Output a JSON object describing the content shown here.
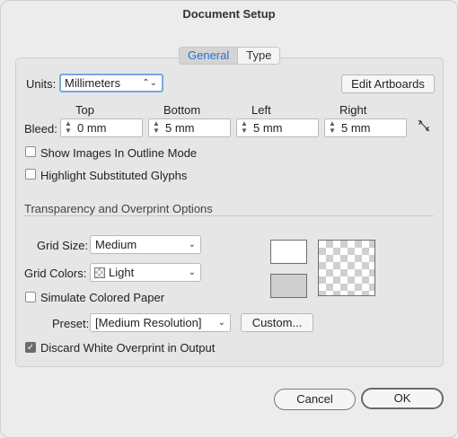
{
  "window": {
    "title": "Document Setup"
  },
  "tabs": [
    {
      "label": "General",
      "active": true
    },
    {
      "label": "Type",
      "active": false
    }
  ],
  "units": {
    "label": "Units:",
    "value": "Millimeters"
  },
  "edit_artboards_label": "Edit Artboards",
  "bleed": {
    "label": "Bleed:",
    "top": {
      "label": "Top",
      "value": "0 mm"
    },
    "bottom": {
      "label": "Bottom",
      "value": "5 mm"
    },
    "left": {
      "label": "Left",
      "value": "5 mm"
    },
    "right": {
      "label": "Right",
      "value": "5 mm"
    },
    "link_icon": "broken-link-icon"
  },
  "options": {
    "show_images_outline": {
      "label": "Show Images In Outline Mode",
      "checked": false
    },
    "highlight_glyphs": {
      "label": "Highlight Substituted Glyphs",
      "checked": false
    }
  },
  "transparency": {
    "section_title": "Transparency and Overprint Options",
    "grid_size": {
      "label": "Grid Size:",
      "value": "Medium"
    },
    "grid_colors": {
      "label": "Grid Colors:",
      "value": "Light"
    },
    "simulate_paper": {
      "label": "Simulate Colored Paper",
      "checked": false
    },
    "preset": {
      "label": "Preset:",
      "value": "[Medium Resolution]"
    },
    "custom_label": "Custom...",
    "discard_white": {
      "label": "Discard White Overprint in Output",
      "checked": true
    },
    "colors": {
      "swatch_white": "#ffffff",
      "swatch_gray": "#cfcfcf"
    }
  },
  "footer": {
    "cancel_label": "Cancel",
    "ok_label": "OK"
  },
  "colors": {
    "accent": "#2b6fc9",
    "background": "#ececec"
  }
}
